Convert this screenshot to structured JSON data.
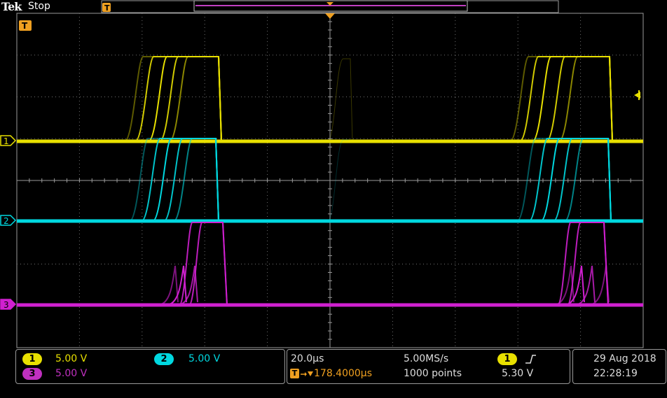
{
  "header": {
    "brand": "Tek",
    "acq_state": "Stop"
  },
  "markers": {
    "trigger_pos": "T"
  },
  "channels": [
    {
      "num": "1",
      "scale": "5.00 V",
      "color": "#e8e000"
    },
    {
      "num": "2",
      "scale": "5.00 V",
      "color": "#00d8e0"
    },
    {
      "num": "3",
      "scale": "5.00 V",
      "color": "#d020d0"
    }
  ],
  "horizontal": {
    "time_div": "20.0µs",
    "sample_rate": "5.00MS/s",
    "delay_symbol": "T",
    "delay": "178.4000µs",
    "record_length": "1000 points"
  },
  "trigger": {
    "source": "1",
    "slope_icon": "rising-edge",
    "level": "5.30 V"
  },
  "datetime": {
    "date": "29 Aug 2018",
    "time": "22:28:19"
  },
  "colors": {
    "grid": "#707070",
    "orange": "#f0a020",
    "border": "#9a9a9a"
  }
}
